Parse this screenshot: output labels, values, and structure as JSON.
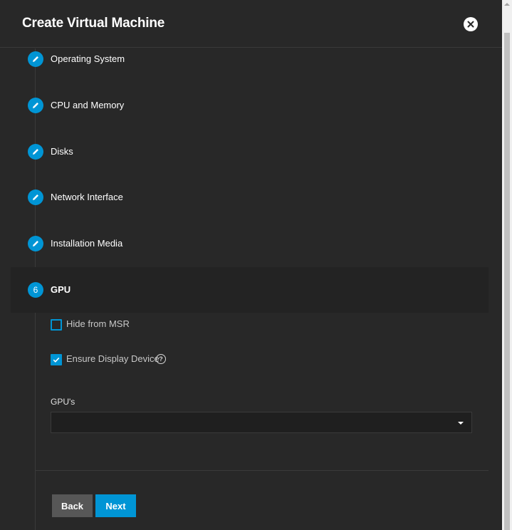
{
  "dialog": {
    "title": "Create Virtual Machine",
    "close_icon": "close-icon"
  },
  "steps": [
    {
      "label": "Operating System",
      "icon": "pencil-icon",
      "state": "edit"
    },
    {
      "label": "CPU and Memory",
      "icon": "pencil-icon",
      "state": "edit"
    },
    {
      "label": "Disks",
      "icon": "pencil-icon",
      "state": "edit"
    },
    {
      "label": "Network Interface",
      "icon": "pencil-icon",
      "state": "edit"
    },
    {
      "label": "Installation Media",
      "icon": "pencil-icon",
      "state": "edit"
    },
    {
      "label": "GPU",
      "number": "6",
      "state": "active"
    }
  ],
  "gpu": {
    "hide_from_msr": {
      "label": "Hide from MSR",
      "checked": false
    },
    "ensure_display_device": {
      "label": "Ensure Display Device",
      "checked": true,
      "help_icon": "help-icon"
    },
    "gpus_label": "GPU's",
    "gpus_value": ""
  },
  "buttons": {
    "back": "Back",
    "next": "Next"
  },
  "colors": {
    "accent": "#0095d5",
    "background": "#282828",
    "back_button": "#575757"
  }
}
